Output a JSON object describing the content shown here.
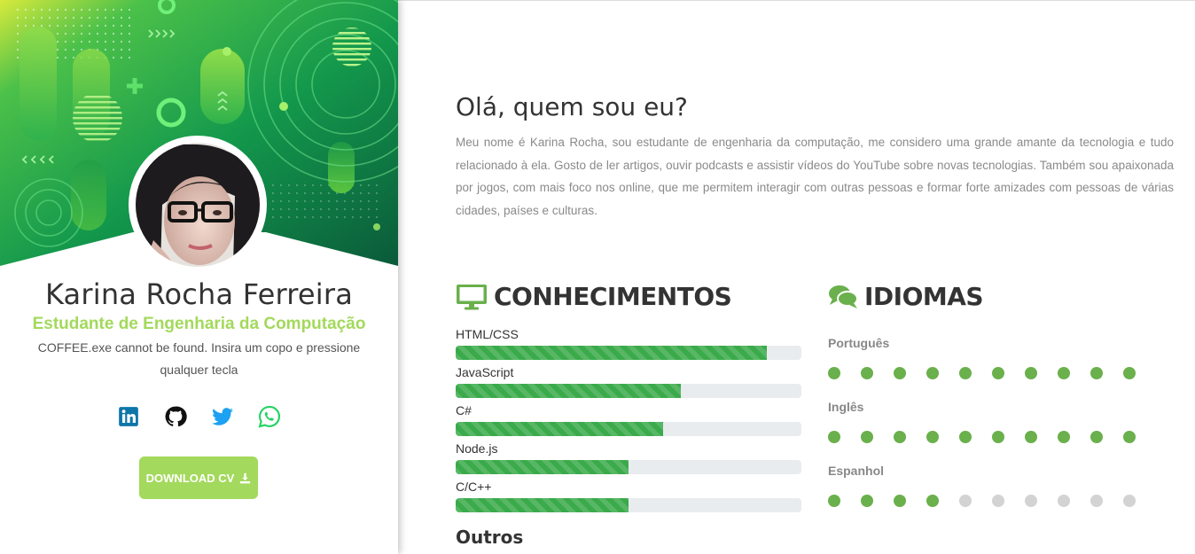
{
  "profile": {
    "name": "Karina Rocha Ferreira",
    "role": "Estudante de Engenharia da Computação",
    "quote": "COFFEE.exe cannot be found. Insira um copo e pressione qualquer tecla",
    "download_label": "DOWNLOAD CV",
    "socials": [
      {
        "icon": "linkedin-icon",
        "color": "#0e76a8"
      },
      {
        "icon": "github-icon",
        "color": "#111111"
      },
      {
        "icon": "twitter-icon",
        "color": "#1da1f2"
      },
      {
        "icon": "whatsapp-icon",
        "color": "#25d366"
      }
    ]
  },
  "about": {
    "title": "Olá, quem sou eu?",
    "text": "Meu nome é Karina Rocha, sou estudante de engenharia da computação, me considero uma grande amante da tecnologia e tudo relacionado à ela. Gosto de ler artigos, ouvir podcasts e assistir vídeos do YouTube sobre novas tecnologias. Também sou apaixonada por jogos, com mais foco nos online, que me permitem interagir com outras pessoas e formar forte amizades com pessoas de várias cidades, países e culturas."
  },
  "skills": {
    "title": "CONHECIMENTOS",
    "icon": "monitor-icon",
    "items": [
      {
        "label": "HTML/CSS",
        "level": 0.9
      },
      {
        "label": "JavaScript",
        "level": 0.65
      },
      {
        "label": "C#",
        "level": 0.6
      },
      {
        "label": "Node.js",
        "level": 0.5
      },
      {
        "label": "C/C++",
        "level": 0.5
      }
    ],
    "other_title": "Outros"
  },
  "languages": {
    "title": "IDIOMAS",
    "icon": "chat-bubbles-icon",
    "max_level": 10,
    "items": [
      {
        "label": "Português",
        "level": 10
      },
      {
        "label": "Inglês",
        "level": 10
      },
      {
        "label": "Espanhol",
        "level": 4
      }
    ]
  },
  "colors": {
    "accent": "#a3d95c",
    "skill_bar": "#3aaa4a",
    "dot_filled": "#6ab04c",
    "dot_empty": "#d3d3d3",
    "icon_green": "#6ab04c"
  }
}
